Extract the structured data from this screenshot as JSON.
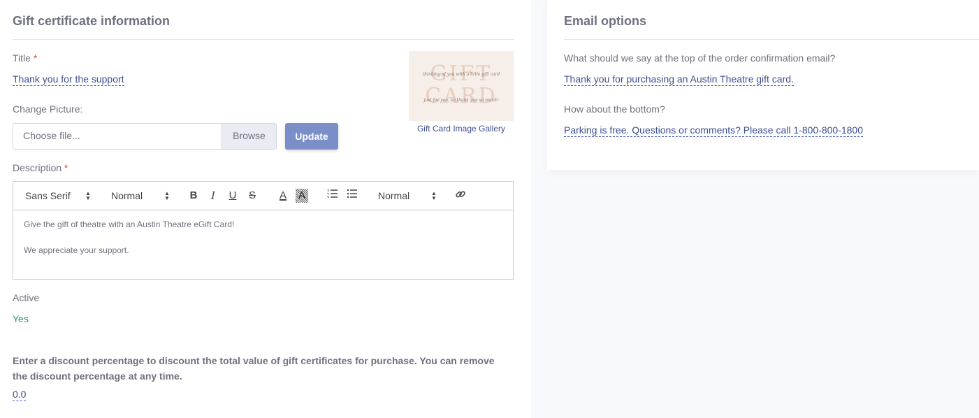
{
  "gift_section": {
    "title": "Gift certificate information",
    "title_label": "Title",
    "required_mark": "*",
    "title_value": "Thank you for the support",
    "change_picture_label": "Change Picture:",
    "file_placeholder": "Choose file...",
    "browse_label": "Browse",
    "update_label": "Update",
    "image_big_text": [
      "GIFT",
      "CARD"
    ],
    "image_script_lines": [
      "thinking of you with a little gift card",
      "just for you, so thank you so much!"
    ],
    "gallery_link": "Gift Card Image Gallery",
    "description_label": "Description",
    "toolbar": {
      "font_family": "Sans Serif",
      "font_size": "Normal",
      "header": "Normal",
      "icons": [
        "bold-icon",
        "italic-icon",
        "underline-icon",
        "strike-icon",
        "text-color-icon",
        "background-color-icon",
        "ordered-list-icon",
        "bullet-list-icon",
        "link-icon"
      ],
      "glyphs": {
        "bold": "B",
        "italic": "I",
        "underline": "U",
        "strike": "S",
        "color": "A"
      }
    },
    "description_lines": [
      "Give the gift of theatre with an Austin Theatre eGift Card!",
      "We appreciate your support."
    ],
    "active_label": "Active",
    "active_value": "Yes",
    "discount_label": "Enter a discount percentage to discount the total value of gift certificates for purchase. You can remove the discount percentage at any time.",
    "discount_value": "0.0"
  },
  "email_section": {
    "title": "Email options",
    "top_question": "What should we say at the top of the order confirmation email?",
    "top_value": "Thank you for purchasing an Austin Theatre gift card.",
    "bottom_question": "How about the bottom?",
    "bottom_value": "Parking is free. Questions or comments? Please call 1-800-800-1800"
  },
  "colors": {
    "accent": "#3c4f8f",
    "update_button": "#7b8ec8",
    "active_green": "#2e9a6c",
    "required_red": "#e74a3b"
  }
}
